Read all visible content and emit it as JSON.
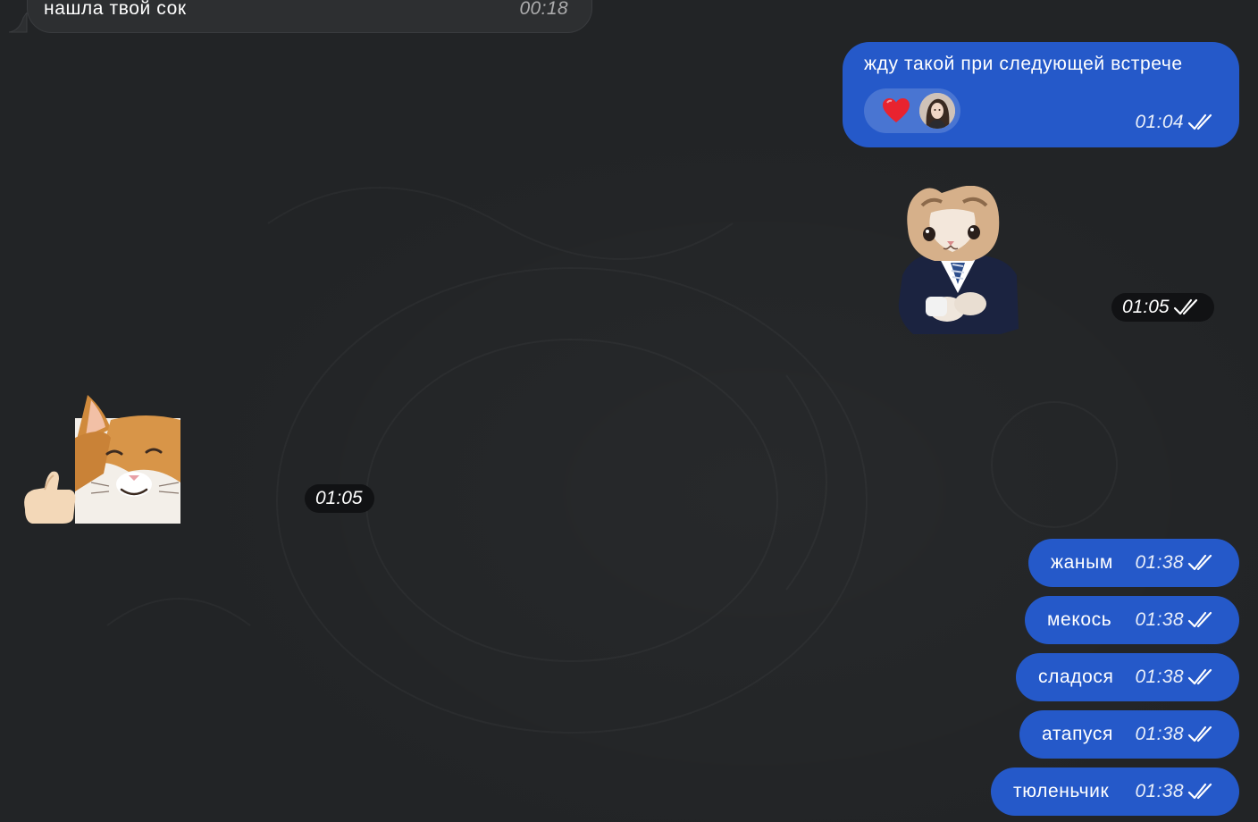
{
  "messages": {
    "top_incoming": {
      "text": "нашла твой сок",
      "time": "00:18"
    },
    "outgoing_main": {
      "text": "жду такой при следующей встрече",
      "time": "01:04"
    },
    "sticker_right": {
      "name": "kitten in suit sticker",
      "time": "01:05"
    },
    "sticker_left": {
      "name": "smiling cat thumbs up sticker",
      "time": "01:05"
    },
    "short_outgoing": [
      {
        "text": "жаным",
        "time": "01:38"
      },
      {
        "text": "мекось",
        "time": "01:38"
      },
      {
        "text": "сладося",
        "time": "01:38"
      },
      {
        "text": "атапуся",
        "time": "01:38"
      },
      {
        "text": "тюленьчик",
        "time": "01:38"
      }
    ]
  },
  "reactions": {
    "emoji_icon": "red-heart-icon",
    "reactor": "user-avatar"
  },
  "colors": {
    "background": "#222426",
    "incoming_bubble": "#2d2f31",
    "outgoing_bubble": "#2559c9",
    "time_pill": "#111214"
  }
}
